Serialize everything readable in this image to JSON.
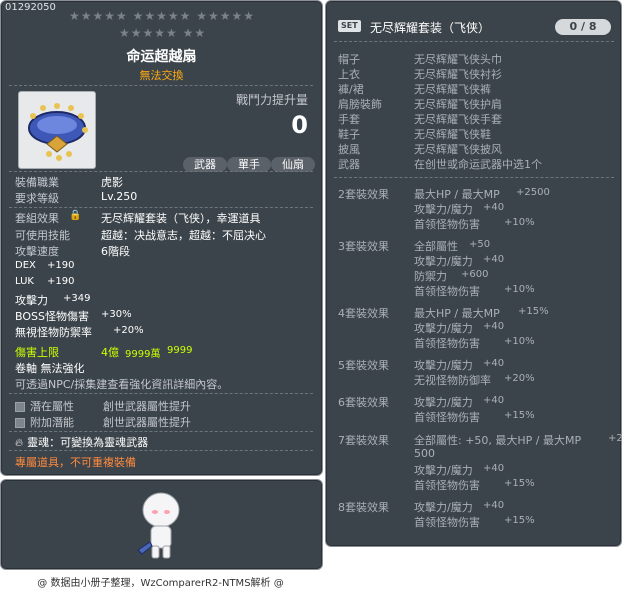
{
  "item_code": "01292050",
  "stars": {
    "row1": "★★★★★  ★★★★★  ★★★★★",
    "row2": "★★★★★  ★★"
  },
  "item_name": "命运超越扇",
  "untradeable": "無法交換",
  "power_label": "戰鬥力提升量",
  "power_value": "0",
  "tags": [
    "武器",
    "單手",
    "仙扇"
  ],
  "req": {
    "job_label": "裝備職業",
    "job_value": "虎影",
    "level_label": "要求等級",
    "level_value": "Lv.250"
  },
  "stats": {
    "set_label": "套組效果",
    "set_value": "无尽辉耀套装（飞侠），幸運道具",
    "skill_label": "可使用技能",
    "skill_value": "超越：决战意志，超越：不屈决心",
    "speed_label": "攻擊速度",
    "speed_value": "6階段",
    "dex_label": "DEX",
    "dex_value": "+190",
    "luk_label": "LUK",
    "luk_value": "+190",
    "atk_label": "攻擊力",
    "atk_value": "+349",
    "boss_label": "BOSS怪物傷害",
    "boss_value": "+30%",
    "ignore_label": "無視怪物防禦率",
    "ignore_value": "+20%"
  },
  "damage_cap": {
    "label": "傷害上限",
    "value_a": "4億",
    "value_b": "9999萬",
    "value_c": "9999"
  },
  "scroll": "卷軸 無法強化",
  "npc_note": "可透過NPC/採集建查看強化資訊詳細內容。",
  "potential": {
    "label": "潛在屬性",
    "value": "創世武器屬性提升"
  },
  "additional": {
    "label": "附加潛能",
    "value": "創世武器屬性提升"
  },
  "soul": {
    "label": "靈魂",
    "value": "：可變換為靈魂武器"
  },
  "exclusive": "專屬道具，不可重複裝備",
  "footer": "@ 数据由小册子整理，WzComparerR2-NTMS解析 @",
  "set_panel": {
    "badge": "SET",
    "title": "无尽辉耀套装（飞侠）",
    "count": "0 / 8",
    "parts": [
      {
        "slot": "帽子",
        "name": "无尽辉耀飞侠头巾"
      },
      {
        "slot": "上衣",
        "name": "无尽辉耀飞侠衬衫"
      },
      {
        "slot": "褲/裙",
        "name": "无尽辉耀飞侠裤"
      },
      {
        "slot": "肩膀裝飾",
        "name": "无尽辉耀飞侠护肩"
      },
      {
        "slot": "手套",
        "name": "无尽辉耀飞侠手套"
      },
      {
        "slot": "鞋子",
        "name": "无尽辉耀飞侠鞋"
      },
      {
        "slot": "披風",
        "name": "无尽辉耀飞侠披风"
      },
      {
        "slot": "武器",
        "name": "在创世或命运武器中选1个"
      }
    ],
    "effects": [
      {
        "label": "2套裝效果",
        "lines": [
          {
            "t": "最大HP / 最大MP",
            "v": "+2500"
          },
          {
            "t": "攻擊力/魔力",
            "v": "+40"
          },
          {
            "t": "首领怪物伤害",
            "v": "+10%"
          }
        ]
      },
      {
        "label": "3套裝效果",
        "lines": [
          {
            "t": "全部屬性",
            "v": "+50"
          },
          {
            "t": "攻擊力/魔力",
            "v": "+40"
          },
          {
            "t": "防禦力",
            "v": "+600"
          },
          {
            "t": "首领怪物伤害",
            "v": "+10%"
          }
        ]
      },
      {
        "label": "4套裝效果",
        "lines": [
          {
            "t": "最大HP / 最大MP",
            "v": "+15%"
          },
          {
            "t": "攻擊力/魔力",
            "v": "+40"
          },
          {
            "t": "首领怪物伤害",
            "v": "+10%"
          }
        ]
      },
      {
        "label": "5套裝效果",
        "lines": [
          {
            "t": "攻擊力/魔力",
            "v": "+40"
          },
          {
            "t": "无视怪物防御率",
            "v": "+20%"
          }
        ]
      },
      {
        "label": "6套裝效果",
        "lines": [
          {
            "t": "攻擊力/魔力",
            "v": "+40"
          },
          {
            "t": "首领怪物伤害",
            "v": "+15%"
          }
        ]
      },
      {
        "label": "7套裝效果",
        "lines": [
          {
            "t": "全部屬性: +50, 最大HP / 最大MP",
            "v": "+2"
          },
          {
            "t": "500",
            "v": ""
          },
          {
            "t": "攻擊力/魔力",
            "v": "+40"
          },
          {
            "t": "首领怪物伤害",
            "v": "+15%"
          }
        ]
      },
      {
        "label": "8套裝效果",
        "lines": [
          {
            "t": "攻擊力/魔力",
            "v": "+40"
          },
          {
            "t": "首领怪物伤害",
            "v": "+15%"
          }
        ]
      }
    ]
  },
  "colors": {
    "panel_bg": "#3c444b",
    "gold": "#ffaa11",
    "green": "#ccff00",
    "orange": "#ff8a3d"
  }
}
